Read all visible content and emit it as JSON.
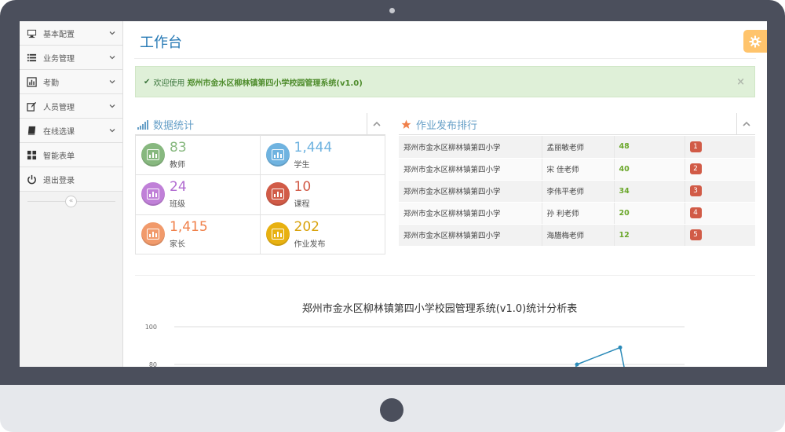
{
  "sidebar": {
    "items": [
      {
        "label": "基本配置",
        "icon": "desktop-icon",
        "has_children": true
      },
      {
        "label": "业务管理",
        "icon": "list-icon",
        "has_children": true
      },
      {
        "label": "考勤",
        "icon": "bar-chart-icon",
        "has_children": true
      },
      {
        "label": "人员管理",
        "icon": "edit-icon",
        "has_children": true
      },
      {
        "label": "在线选课",
        "icon": "book-icon",
        "has_children": true
      },
      {
        "label": "智能表单",
        "icon": "grid-icon",
        "has_children": false
      },
      {
        "label": "退出登录",
        "icon": "power-icon",
        "has_children": false
      }
    ],
    "collapse_icon": "double-chevron-left-icon"
  },
  "header": {
    "title": "工作台",
    "settings_icon": "gear-icon"
  },
  "alert": {
    "prefix": "欢迎使用",
    "system_name": "郑州市金水区柳林镇第四小学校园管理系统(v1.0)",
    "close": "×"
  },
  "stats": {
    "title": "数据统计",
    "icon": "signal-icon",
    "items": [
      {
        "value": "83",
        "label": "教师",
        "color": "#87b87f"
      },
      {
        "value": "1,444",
        "label": "学生",
        "color": "#6fb3e0"
      },
      {
        "value": "24",
        "label": "班级",
        "color": "#c080d8"
      },
      {
        "value": "10",
        "label": "课程",
        "color": "#d15b47"
      },
      {
        "value": "1,415",
        "label": "家长",
        "color": "#f19a6b"
      },
      {
        "value": "202",
        "label": "作业发布",
        "color": "#e8b110"
      }
    ]
  },
  "ranking": {
    "title": "作业发布排行",
    "icon": "star-icon",
    "rows": [
      {
        "school": "郑州市金水区柳林镇第四小学",
        "teacher": "孟丽敏老师",
        "count": "48",
        "rank": "1"
      },
      {
        "school": "郑州市金水区柳林镇第四小学",
        "teacher": "宋 佳老师",
        "count": "40",
        "rank": "2"
      },
      {
        "school": "郑州市金水区柳林镇第四小学",
        "teacher": "李伟平老师",
        "count": "34",
        "rank": "3"
      },
      {
        "school": "郑州市金水区柳林镇第四小学",
        "teacher": "孙 利老师",
        "count": "20",
        "rank": "4"
      },
      {
        "school": "郑州市金水区柳林镇第四小学",
        "teacher": "海腊梅老师",
        "count": "12",
        "rank": "5"
      }
    ]
  },
  "chart_data": {
    "type": "line",
    "title": "郑州市金水区柳林镇第四小学校园管理系统(v1.0)统计分析表",
    "yticks": [
      "100",
      "80"
    ],
    "ylim_visible": [
      80,
      100
    ],
    "series_color": "#2a8ab8",
    "points_visible": [
      {
        "y": 80
      },
      {
        "y": 89
      }
    ]
  },
  "colors": {
    "accent": "#2679b5",
    "success_bg": "#dff0d8",
    "badge": "#d15b47",
    "count_green": "#6aa72a"
  }
}
